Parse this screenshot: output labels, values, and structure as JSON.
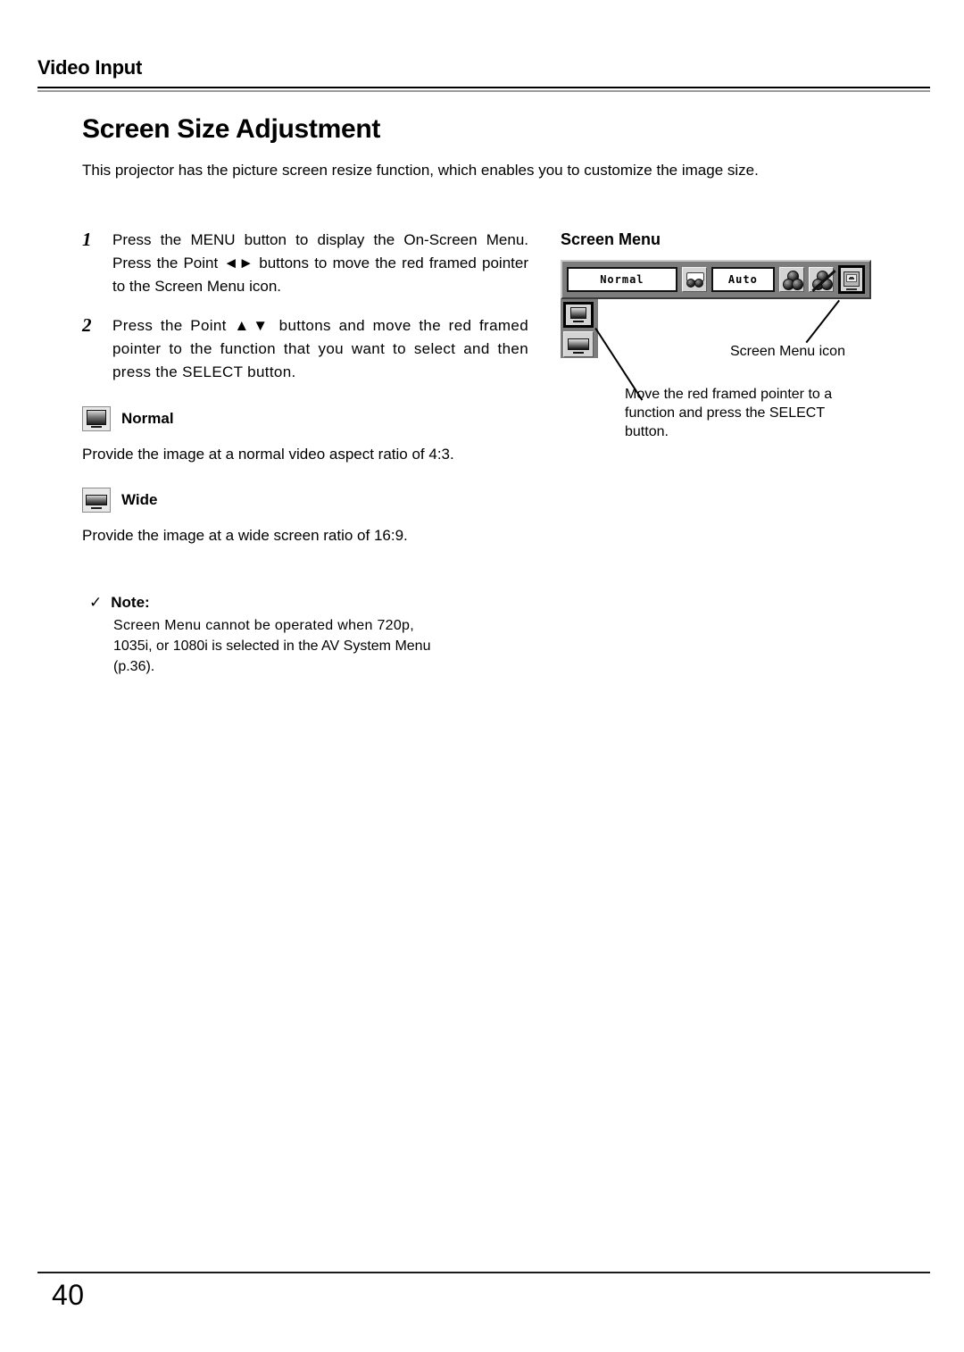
{
  "header": {
    "running_title": "Video Input"
  },
  "title": "Screen Size Adjustment",
  "intro": "This projector has the picture screen resize function, which enables you to customize the image size.",
  "steps": [
    {
      "number": "1",
      "text": "Press the MENU button to display the On-Screen Menu.  Press the Point ◄► buttons to move the red framed pointer to the Screen Menu icon."
    },
    {
      "number": "2",
      "text": "Press the Point ▲▼ buttons and move the red framed pointer to the function that you want to select and then press the SELECT button."
    }
  ],
  "functions": [
    {
      "icon": "normal-screen-icon",
      "label": "Normal",
      "description": "Provide the image at a normal video aspect ratio of 4:3."
    },
    {
      "icon": "wide-screen-icon",
      "label": "Wide",
      "description": "Provide the image at a wide screen ratio of 16:9."
    }
  ],
  "note": {
    "check_glyph": "✓",
    "title": "Note:",
    "body_line1": "Screen Menu cannot be operated when 720p,",
    "body_line2": "1035i, or 1080i is selected in the AV System Menu",
    "body_line3": "(p.36)."
  },
  "figure": {
    "title": "Screen Menu",
    "osd": {
      "field_normal": "Normal",
      "field_auto": "Auto",
      "icons": [
        "video-source-icon",
        "color-balls-icon",
        "color-balls-off-icon",
        "screen-menu-icon"
      ],
      "submenu": [
        "normal-screen-icon",
        "wide-screen-icon"
      ]
    },
    "callouts": {
      "icon_label": "Screen Menu icon",
      "move_line1": "Move the red framed pointer to a",
      "move_line2": "function and press the SELECT",
      "move_line3": "button."
    }
  },
  "footer": {
    "page_number": "40"
  },
  "colors": {
    "osd_background": "#7d7d7d",
    "osd_field_background": "#ffffff",
    "selected_border": "#000000",
    "rule_dark": "#000000",
    "rule_light": "#9a9a9a"
  }
}
